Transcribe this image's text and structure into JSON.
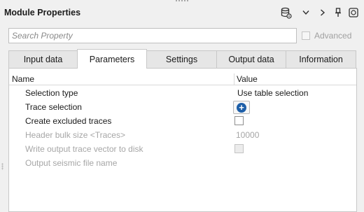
{
  "window": {
    "title": "Module Properties",
    "toolbar_icons": [
      "database-settings-icon",
      "chevron-down-icon",
      "chevron-right-icon",
      "pin-icon",
      "close-icon"
    ]
  },
  "search": {
    "value": "",
    "placeholder": "Search Property"
  },
  "advanced": {
    "label": "Advanced",
    "checked": false,
    "enabled": false
  },
  "tabs": [
    {
      "label": "Input data",
      "active": false
    },
    {
      "label": "Parameters",
      "active": true
    },
    {
      "label": "Settings",
      "active": false
    },
    {
      "label": "Output data",
      "active": false
    },
    {
      "label": "Information",
      "active": false
    }
  ],
  "grid": {
    "columns": [
      "Name",
      "Value"
    ],
    "rows": [
      {
        "name": "Selection type",
        "value": "Use table selection",
        "kind": "text",
        "enabled": true
      },
      {
        "name": "Trace selection",
        "value": "",
        "kind": "add-button",
        "enabled": true
      },
      {
        "name": "Create excluded traces",
        "value": "",
        "kind": "checkbox",
        "enabled": true
      },
      {
        "name": "Header bulk size <Traces>",
        "value": "10000",
        "kind": "text",
        "enabled": false
      },
      {
        "name": "Write output trace vector to disk",
        "value": "",
        "kind": "checkbox",
        "enabled": false
      },
      {
        "name": "Output seismic file name",
        "value": "",
        "kind": "text",
        "enabled": false
      }
    ]
  },
  "colors": {
    "add_button": "#1e5fa8",
    "disabled_text": "#a6a6a6"
  }
}
